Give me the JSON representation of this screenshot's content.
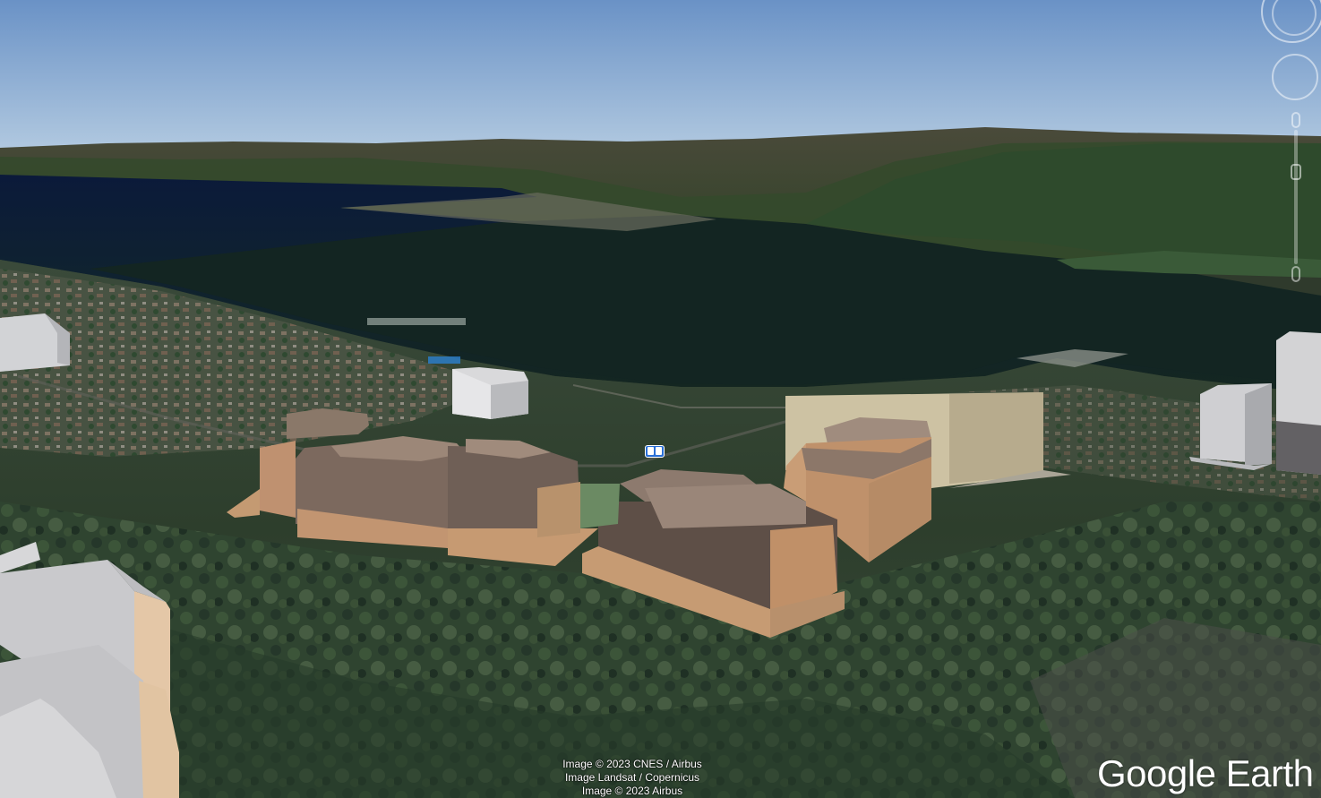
{
  "map": {
    "view": "3d-tilted",
    "imagery": "satellite",
    "buildings_3d": true
  },
  "attribution": {
    "line1": "Image © 2023 CNES / Airbus",
    "line2": "Image Landsat / Copernicus",
    "line3": "Image © 2023 Airbus"
  },
  "logo": {
    "text": "Google Earth"
  },
  "controls": {
    "compass_icon": "compass-icon",
    "tilt_icon": "tilt-icon",
    "zoom_icon": "zoom-slider-icon",
    "transit_icon": "transit-station-icon"
  },
  "colors": {
    "sky_top": "#6f96c8",
    "sky_bottom": "#b3cbe2",
    "lake_far": "#0d1c3b",
    "lake_near": "#132520",
    "building_tan": "#c09268",
    "building_brown": "#7d6a5f",
    "building_beige": "#cec3a5",
    "building_grey": "#d4d4d6"
  }
}
